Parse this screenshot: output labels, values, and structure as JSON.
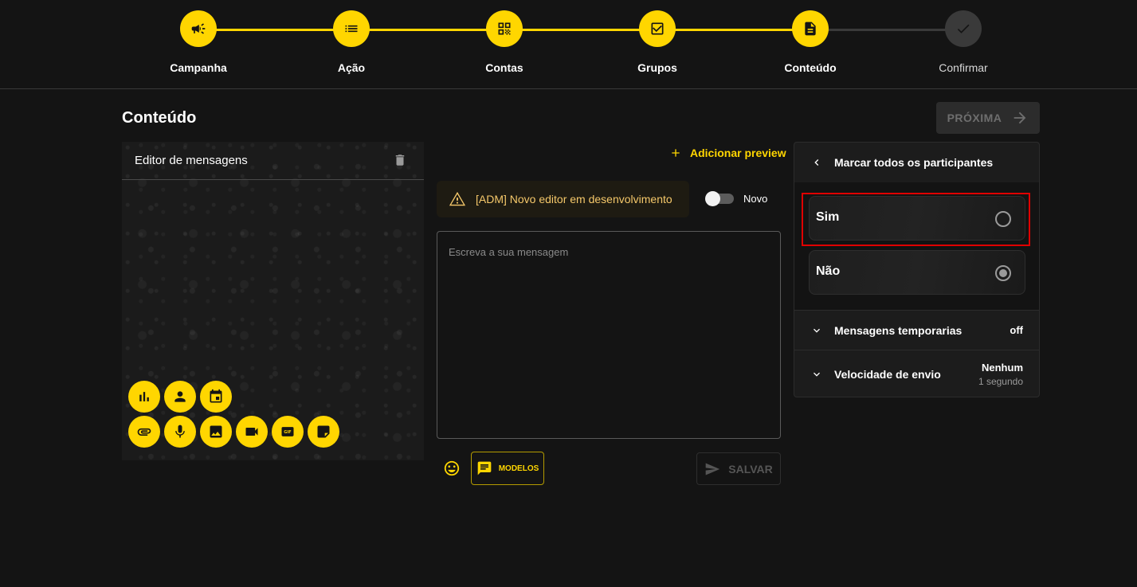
{
  "stepper": {
    "steps": [
      {
        "label": "Campanha",
        "icon": "megaphone-icon",
        "active": true
      },
      {
        "label": "Ação",
        "icon": "list-icon",
        "active": true
      },
      {
        "label": "Contas",
        "icon": "qr-code-icon",
        "active": true
      },
      {
        "label": "Grupos",
        "icon": "checkbox-icon",
        "active": true
      },
      {
        "label": "Conteúdo",
        "icon": "document-icon",
        "active": true
      },
      {
        "label": "Confirmar",
        "icon": "check-icon",
        "active": false
      }
    ],
    "accent_color": "#ffd600",
    "inactive_color": "#3a3a3a"
  },
  "page": {
    "title": "Conteúdo",
    "next_label": "PRÓXIMA"
  },
  "editor": {
    "title": "Editor de mensagens",
    "tools_row1": [
      "poll-icon",
      "contact-icon",
      "calendar-icon"
    ],
    "tools_row2": [
      "attachment-icon",
      "microphone-icon",
      "image-icon",
      "video-icon",
      "gif-icon",
      "sticker-icon"
    ]
  },
  "composer": {
    "add_preview_label": "Adicionar preview",
    "warning_text": "[ADM] Novo editor em desenvolvimento",
    "toggle_label": "Novo",
    "toggle_on": false,
    "message_placeholder": "Escreva a sua mensagem",
    "models_label": "MODELOS",
    "save_label": "SALVAR"
  },
  "settings": {
    "mark_all_title": "Marcar todos os participantes",
    "options": [
      {
        "label": "Sim",
        "checked": false
      },
      {
        "label": "Não",
        "checked": true
      }
    ],
    "temp_messages_label": "Mensagens temporarias",
    "temp_messages_value": "off",
    "speed_label": "Velocidade de envio",
    "speed_value": "Nenhum",
    "speed_sub": "1 segundo"
  }
}
